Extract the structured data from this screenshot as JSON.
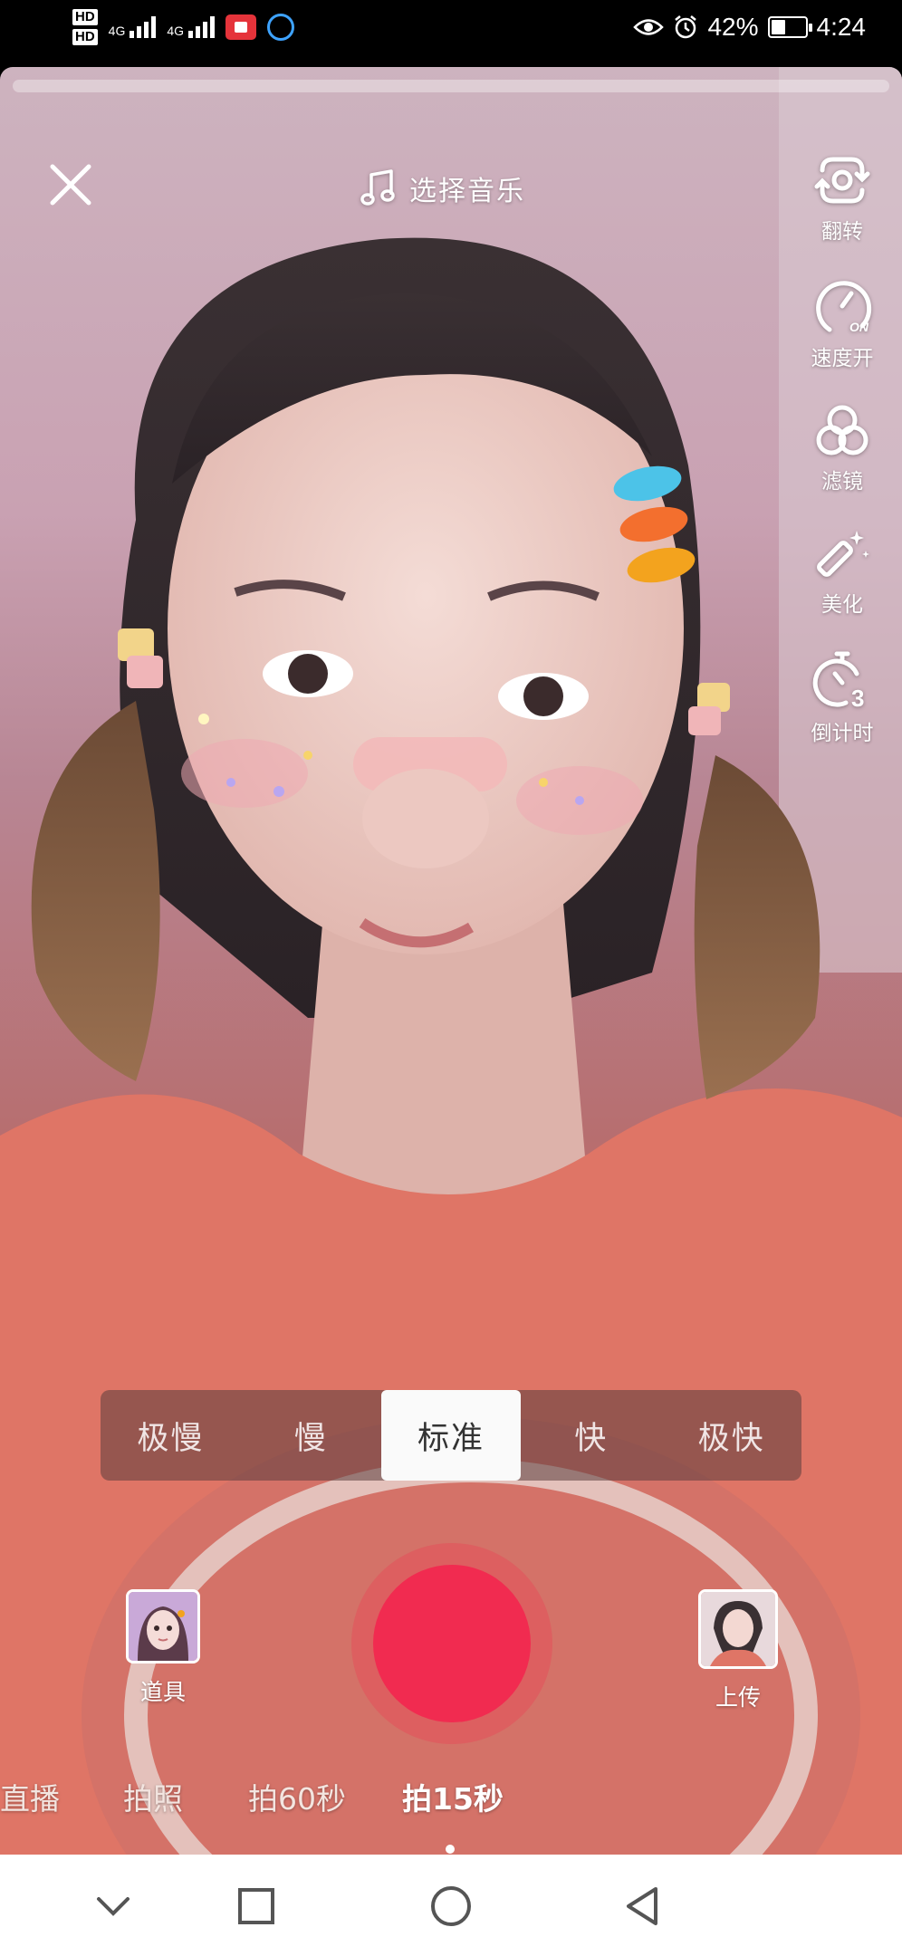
{
  "status_bar": {
    "hd1": "HD",
    "hd2": "HD",
    "net1": "4G",
    "net2": "4G",
    "battery_text": "42%",
    "battery_level": 0.42,
    "time": "4:24"
  },
  "music": {
    "label": "选择音乐"
  },
  "tools": [
    {
      "label": "翻转",
      "icon": "flip-camera-icon"
    },
    {
      "label": "速度开",
      "icon": "speed-on-icon"
    },
    {
      "label": "滤镜",
      "icon": "filter-icon"
    },
    {
      "label": "美化",
      "icon": "beauty-wand-icon"
    },
    {
      "label": "倒计时",
      "icon": "countdown-timer-icon"
    }
  ],
  "speed": {
    "options": [
      "极慢",
      "慢",
      "标准",
      "快",
      "极快"
    ],
    "selected": "标准"
  },
  "props": {
    "label": "道具"
  },
  "upload": {
    "label": "上传"
  },
  "modes": {
    "items": [
      "直播",
      "拍照",
      "拍60秒",
      "拍15秒"
    ],
    "selected": "拍15秒"
  },
  "colors": {
    "record": "#f12b50",
    "accent_ring": "#ee3c54"
  }
}
